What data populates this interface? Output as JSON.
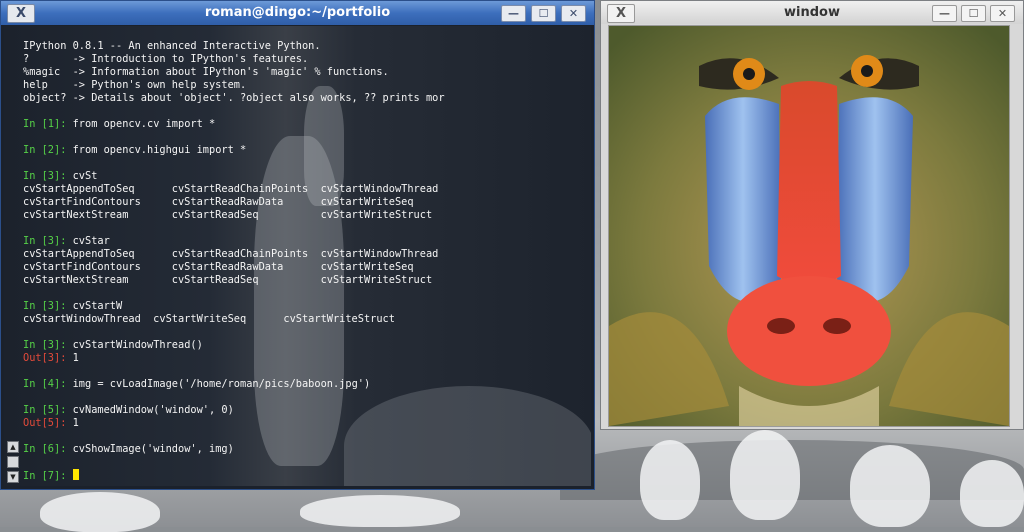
{
  "terminal": {
    "title": "roman@dingo:~/portfolio",
    "lines": [
      {
        "kind": "text",
        "text": "IPython 0.8.1 -- An enhanced Interactive Python."
      },
      {
        "kind": "text",
        "text": "?       -> Introduction to IPython's features."
      },
      {
        "kind": "text",
        "text": "%magic  -> Information about IPython's 'magic' % functions."
      },
      {
        "kind": "text",
        "text": "help    -> Python's own help system."
      },
      {
        "kind": "text",
        "text": "object? -> Details about 'object'. ?object also works, ?? prints mor"
      },
      {
        "kind": "blank",
        "text": ""
      },
      {
        "kind": "in",
        "prompt": "In [1]:",
        "text": "from opencv.cv import *"
      },
      {
        "kind": "blank",
        "text": ""
      },
      {
        "kind": "in",
        "prompt": "In [2]:",
        "text": "from opencv.highgui import *"
      },
      {
        "kind": "blank",
        "text": ""
      },
      {
        "kind": "in",
        "prompt": "In [3]:",
        "text": "cvSt"
      },
      {
        "kind": "text",
        "text": "cvStartAppendToSeq      cvStartReadChainPoints  cvStartWindowThread"
      },
      {
        "kind": "text",
        "text": "cvStartFindContours     cvStartReadRawData      cvStartWriteSeq"
      },
      {
        "kind": "text",
        "text": "cvStartNextStream       cvStartReadSeq          cvStartWriteStruct"
      },
      {
        "kind": "blank",
        "text": ""
      },
      {
        "kind": "in",
        "prompt": "In [3]:",
        "text": "cvStar"
      },
      {
        "kind": "text",
        "text": "cvStartAppendToSeq      cvStartReadChainPoints  cvStartWindowThread"
      },
      {
        "kind": "text",
        "text": "cvStartFindContours     cvStartReadRawData      cvStartWriteSeq"
      },
      {
        "kind": "text",
        "text": "cvStartNextStream       cvStartReadSeq          cvStartWriteStruct"
      },
      {
        "kind": "blank",
        "text": ""
      },
      {
        "kind": "in",
        "prompt": "In [3]:",
        "text": "cvStartW"
      },
      {
        "kind": "text",
        "text": "cvStartWindowThread  cvStartWriteSeq      cvStartWriteStruct"
      },
      {
        "kind": "blank",
        "text": ""
      },
      {
        "kind": "in",
        "prompt": "In [3]:",
        "text": "cvStartWindowThread()"
      },
      {
        "kind": "out",
        "prompt": "Out[3]:",
        "text": "1"
      },
      {
        "kind": "blank",
        "text": ""
      },
      {
        "kind": "in",
        "prompt": "In [4]:",
        "text": "img = cvLoadImage('/home/roman/pics/baboon.jpg')"
      },
      {
        "kind": "blank",
        "text": ""
      },
      {
        "kind": "in",
        "prompt": "In [5]:",
        "text": "cvNamedWindow('window', 0)"
      },
      {
        "kind": "out",
        "prompt": "Out[5]:",
        "text": "1"
      },
      {
        "kind": "blank",
        "text": ""
      },
      {
        "kind": "in",
        "prompt": "In [6]:",
        "text": "cvShowImage('window', img)"
      },
      {
        "kind": "blank",
        "text": ""
      },
      {
        "kind": "in",
        "prompt": "In [7]:",
        "text": "",
        "cursor": true
      }
    ]
  },
  "image_window": {
    "title": "window",
    "image_subject": "mandrill baboon face"
  },
  "icons": {
    "window_menu": "X",
    "minimize": "—",
    "maximize": "☐",
    "close": "✕"
  },
  "colors": {
    "prompt_in": "#55d048",
    "prompt_out": "#e34a3a",
    "cursor": "#ffe600",
    "titlebar_active": "#3d6fbd"
  }
}
